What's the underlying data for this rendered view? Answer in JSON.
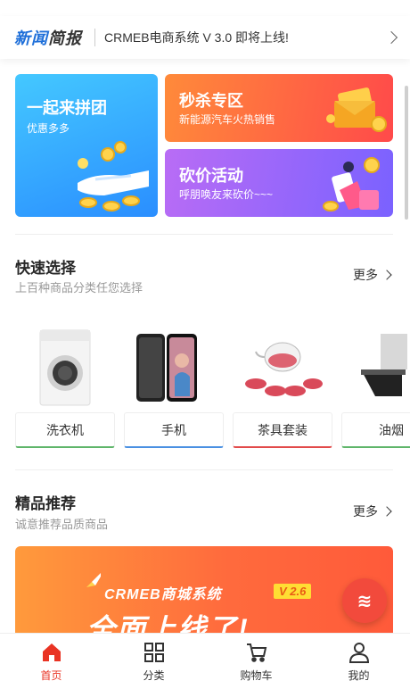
{
  "news": {
    "logo_part1": "新闻",
    "logo_part2": "简报",
    "text": "CRMEB电商系统 V 3.0 即将上线!"
  },
  "promos": {
    "group": {
      "title": "一起来拼团",
      "subtitle": "优惠多多"
    },
    "seckill": {
      "title": "秒杀专区",
      "subtitle": "新能源汽车火热销售"
    },
    "bargain": {
      "title": "砍价活动",
      "subtitle": "呼朋唤友来砍价~~~"
    }
  },
  "quick_select": {
    "title": "快速选择",
    "subtitle": "上百种商品分类任您选择",
    "more": "更多",
    "items": [
      {
        "label": "洗衣机",
        "accent": "#5fb56a",
        "icon": "washing-machine-icon"
      },
      {
        "label": "手机",
        "accent": "#4a90e2",
        "icon": "phone-icon"
      },
      {
        "label": "茶具套装",
        "accent": "#e24a4a",
        "icon": "tea-set-icon"
      },
      {
        "label": "油烟",
        "accent": "#5fb56a",
        "icon": "range-hood-icon"
      }
    ]
  },
  "recommend": {
    "title": "精品推荐",
    "subtitle": "诚意推荐品质商品",
    "more": "更多",
    "banner_line1": "CRMEB商城系统",
    "banner_tag": "V 2.6",
    "banner_line2": "全面上线了!"
  },
  "tabbar": [
    {
      "label": "首页",
      "icon": "home-icon",
      "active": true
    },
    {
      "label": "分类",
      "icon": "category-icon",
      "active": false
    },
    {
      "label": "购物车",
      "icon": "cart-icon",
      "active": false
    },
    {
      "label": "我的",
      "icon": "user-icon",
      "active": false
    }
  ],
  "colors": {
    "brand": "#e93323",
    "news_blue": "#1e6fd9"
  }
}
